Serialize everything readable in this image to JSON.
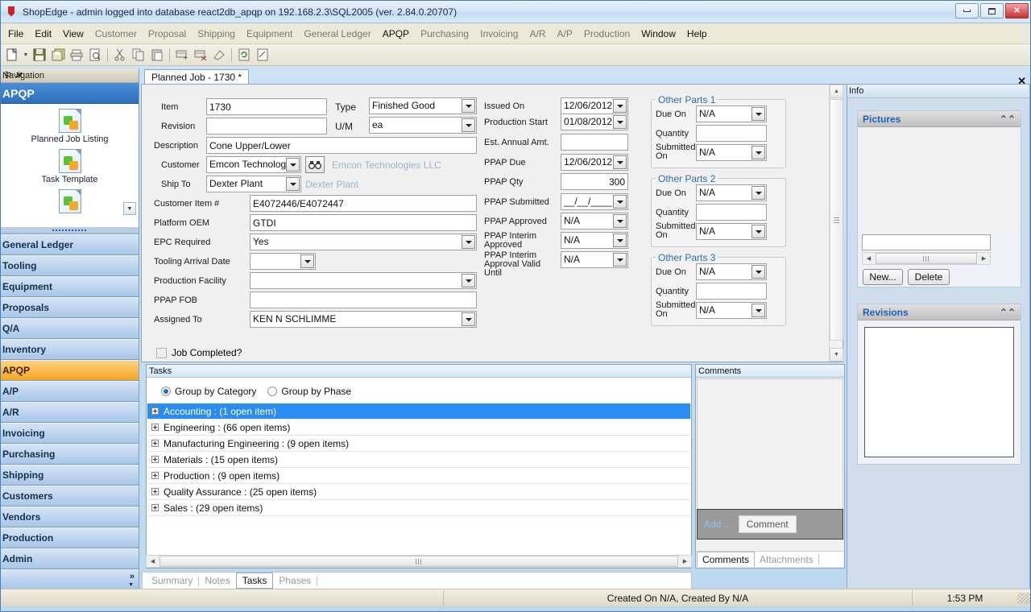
{
  "window": {
    "title": "ShopEdge - admin logged into database react2db_apqp on 192.168.2.3\\SQL2005 (ver. 2.84.0.20707)",
    "minimize": "–",
    "maximize": "□",
    "close": "✕"
  },
  "menu": [
    {
      "label": "File",
      "enabled": true
    },
    {
      "label": "Edit",
      "enabled": true
    },
    {
      "label": "View",
      "enabled": true
    },
    {
      "label": "Customer",
      "enabled": false
    },
    {
      "label": "Proposal",
      "enabled": false
    },
    {
      "label": "Shipping",
      "enabled": false
    },
    {
      "label": "Equipment",
      "enabled": false
    },
    {
      "label": "General Ledger",
      "enabled": false
    },
    {
      "label": "APQP",
      "enabled": true
    },
    {
      "label": "Purchasing",
      "enabled": false
    },
    {
      "label": "Invoicing",
      "enabled": false
    },
    {
      "label": "A/R",
      "enabled": false
    },
    {
      "label": "A/P",
      "enabled": false
    },
    {
      "label": "Production",
      "enabled": false
    },
    {
      "label": "Window",
      "enabled": true
    },
    {
      "label": "Help",
      "enabled": true
    }
  ],
  "toolbar": {
    "icons": [
      "new-document-icon",
      "dropdown-caret-icon",
      "save-icon",
      "save-all-icon",
      "print-icon",
      "print-preview-icon",
      "cut-icon",
      "copy-icon",
      "paste-icon",
      "add-record-icon",
      "delete-record-icon",
      "post-icon",
      "refresh-icon",
      "edit-note-icon"
    ]
  },
  "navigation": {
    "header": "Navigation",
    "pin": "⚐",
    "close": "✕",
    "active_group": "APQP",
    "shortcuts": [
      {
        "label": "Planned Job Listing"
      },
      {
        "label": "Task Template"
      }
    ],
    "groups": [
      "General Ledger",
      "Tooling",
      "Equipment",
      "Proposals",
      "Q/A",
      "Inventory",
      "APQP",
      "A/P",
      "A/R",
      "Invoicing",
      "Purchasing",
      "Shipping",
      "Customers",
      "Vendors",
      "Production",
      "Admin"
    ],
    "active_index": 6
  },
  "document": {
    "tab_label": "Planned Job - 1730 *"
  },
  "form": {
    "left": {
      "item": {
        "label": "Item",
        "value": "1730"
      },
      "revision": {
        "label": "Revision",
        "value": ""
      },
      "description": {
        "label": "Description",
        "value": "Cone Upper/Lower"
      },
      "customer": {
        "label": "Customer",
        "value": "Emcon Technologi",
        "ghost": "Emcon Technologies LLC"
      },
      "ship_to": {
        "label": "Ship To",
        "value": "Dexter Plant",
        "ghost": "Dexter Plant"
      },
      "customer_item": {
        "label": "Customer Item #",
        "value": "E4072446/E4072447"
      },
      "platform_oem": {
        "label": "Platform OEM",
        "value": "GTDI"
      },
      "epc_required": {
        "label": "EPC Required",
        "value": "Yes"
      },
      "tooling_arrival": {
        "label": "Tooling Arrival Date",
        "value": ""
      },
      "production_facility": {
        "label": "Production Facility",
        "value": ""
      },
      "ppap_fob": {
        "label": "PPAP FOB",
        "value": ""
      },
      "assigned_to": {
        "label": "Assigned To",
        "value": "KEN N SCHLIMME"
      },
      "job_completed": {
        "label": "Job Completed?",
        "checked": false
      }
    },
    "type": {
      "label": "Type",
      "value": "Finished Good"
    },
    "um": {
      "label": "U/M",
      "value": "ea"
    },
    "middle": [
      {
        "label": "Issued On",
        "value": "12/06/2012",
        "combo": true
      },
      {
        "label": "Production Start",
        "value": "01/08/2012",
        "combo": true
      },
      {
        "label": "Est. Annual Amt.",
        "value": "",
        "combo": false
      },
      {
        "label": "PPAP Due",
        "value": "12/06/2012",
        "combo": true
      },
      {
        "label": "PPAP Qty",
        "value": "300",
        "combo": false,
        "right": true
      },
      {
        "label": "PPAP Submitted",
        "value": "__/__/____",
        "combo": true
      },
      {
        "label": "PPAP Approved",
        "value": "N/A",
        "combo": true
      },
      {
        "label": "PPAP Interim Approved",
        "value": "N/A",
        "combo": true
      },
      {
        "label": "PPAP Interim Approval Valid Until",
        "value": "N/A",
        "combo": true
      }
    ],
    "other_parts": [
      {
        "title": "Other Parts 1",
        "due_on_label": "Due On",
        "due_on": "N/A",
        "quantity_label": "Quantity",
        "quantity": "",
        "submitted_label": "Submitted On",
        "submitted": "N/A"
      },
      {
        "title": "Other Parts 2",
        "due_on_label": "Due On",
        "due_on": "N/A",
        "quantity_label": "Quantity",
        "quantity": "",
        "submitted_label": "Submitted On",
        "submitted": "N/A"
      },
      {
        "title": "Other Parts 3",
        "due_on_label": "Due On",
        "due_on": "N/A",
        "quantity_label": "Quantity",
        "quantity": "",
        "submitted_label": "Submitted On",
        "submitted": "N/A"
      }
    ]
  },
  "info": {
    "header": "Info",
    "close": "✕",
    "pictures": {
      "title": "Pictures",
      "collapse": "«",
      "filename": "",
      "new_button": "New...",
      "delete_button": "Delete"
    },
    "revisions": {
      "title": "Revisions",
      "collapse": "«"
    }
  },
  "tasks": {
    "header": "Tasks",
    "group_by_category": "Group by Category",
    "group_by_phase": "Group by Phase",
    "selected_group_by": "category",
    "rows": [
      {
        "label": "Accounting : (1 open item)",
        "selected": true
      },
      {
        "label": "Engineering : (66 open items)",
        "selected": false
      },
      {
        "label": "Manufacturing Engineering : (9 open items)",
        "selected": false
      },
      {
        "label": "Materials : (15 open items)",
        "selected": false
      },
      {
        "label": "Production : (9 open items)",
        "selected": false
      },
      {
        "label": "Quality Assurance : (25 open items)",
        "selected": false
      },
      {
        "label": "Sales : (29 open items)",
        "selected": false
      }
    ]
  },
  "comments": {
    "header": "Comments",
    "add_label": "Add ...",
    "comment_button": "Comment",
    "tabs": [
      {
        "label": "Comments",
        "active": true
      },
      {
        "label": "Attachments",
        "active": false
      }
    ]
  },
  "bottom_tabs": [
    {
      "label": "Summary",
      "active": false
    },
    {
      "label": "Notes",
      "active": false
    },
    {
      "label": "Tasks",
      "active": true
    },
    {
      "label": "Phases",
      "active": false
    }
  ],
  "statusbar": {
    "left": "",
    "middle": "Created On N/A, Created By N/A",
    "time": "1:53 PM"
  }
}
